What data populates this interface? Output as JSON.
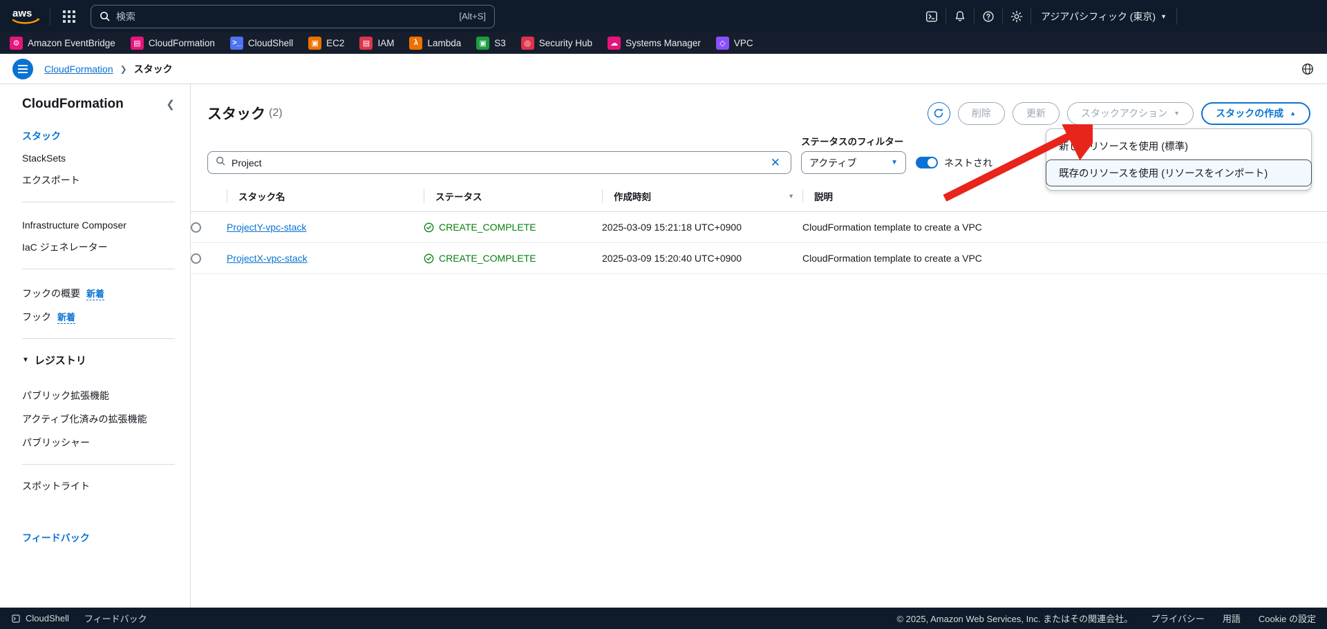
{
  "topnav": {
    "logo_alt": "aws",
    "search_placeholder": "検索",
    "search_shortcut": "[Alt+S]",
    "region_label": "アジアパシフィック (東京)",
    "caret": "▼",
    "icons": {
      "apps": "app-grid-icon",
      "search": "search-icon",
      "cloudshell": "cloudshell-icon",
      "notifications": "bell-icon",
      "help": "question-icon",
      "settings": "gear-icon"
    }
  },
  "favorites": [
    {
      "label": "Amazon EventBridge",
      "color": "#e7157b",
      "glyph": "⚙"
    },
    {
      "label": "CloudFormation",
      "color": "#e7157b",
      "glyph": "▤"
    },
    {
      "label": "CloudShell",
      "color": "#4d72f3",
      "glyph": ">_"
    },
    {
      "label": "EC2",
      "color": "#ed7100",
      "glyph": "▣"
    },
    {
      "label": "IAM",
      "color": "#dd344c",
      "glyph": "▤"
    },
    {
      "label": "Lambda",
      "color": "#ed7100",
      "glyph": "λ"
    },
    {
      "label": "S3",
      "color": "#1b9e3e",
      "glyph": "▣"
    },
    {
      "label": "Security Hub",
      "color": "#dd344c",
      "glyph": "◎"
    },
    {
      "label": "Systems Manager",
      "color": "#e7157b",
      "glyph": "☁"
    },
    {
      "label": "VPC",
      "color": "#8c4fff",
      "glyph": "◇"
    }
  ],
  "breadcrumb": {
    "root": "CloudFormation",
    "separator": "❯",
    "current": "スタック",
    "right_icon": "region-globe-icon"
  },
  "sidebar": {
    "title": "CloudFormation",
    "collapse_icon": "❮",
    "items": [
      {
        "label": "スタック",
        "active": true
      },
      {
        "label": "StackSets",
        "active": false
      },
      {
        "label": "エクスポート",
        "active": false
      }
    ],
    "items2": [
      {
        "label": "Infrastructure Composer"
      },
      {
        "label": "IaC ジェネレーター"
      }
    ],
    "items3": [
      {
        "label": "フックの概要",
        "badge": "新着"
      },
      {
        "label": "フック",
        "badge": "新着"
      }
    ],
    "registry_group": "レジストリ",
    "registry_caret": "▼",
    "registry_items": [
      {
        "label": "パブリック拡張機能"
      },
      {
        "label": "アクティブ化済みの拡張機能"
      },
      {
        "label": "パブリッシャー"
      }
    ],
    "spotlight": "スポットライト",
    "feedback": "フィードバック"
  },
  "panel": {
    "title": "スタック",
    "count": "(2)",
    "refresh_icon": "refresh-icon",
    "buttons": {
      "delete": "削除",
      "update": "更新",
      "stack_actions": "スタックアクション",
      "create_stack": "スタックの作成"
    },
    "caret_down": "▼",
    "caret_up": "▲",
    "dropdown": [
      {
        "label": "新しいリソースを使用 (標準)",
        "hover": false
      },
      {
        "label": "既存のリソースを使用 (リソースをインポート)",
        "hover": true
      }
    ]
  },
  "filters": {
    "search_value": "Project",
    "search_placeholder": "Project",
    "clear_icon": "✕",
    "status_label": "ステータスのフィルター",
    "status_value": "アクティブ",
    "status_caret": "▼",
    "nested_toggle_label": "ネストされ",
    "toggle_on": true
  },
  "table": {
    "columns": [
      "スタック名",
      "ステータス",
      "作成時刻",
      "説明"
    ],
    "sort_caret": "▼",
    "rows": [
      {
        "name": "ProjectY-vpc-stack",
        "status": "CREATE_COMPLETE",
        "created": "2025-03-09 15:21:18 UTC+0900",
        "description": "CloudFormation template to create a VPC"
      },
      {
        "name": "ProjectX-vpc-stack",
        "status": "CREATE_COMPLETE",
        "created": "2025-03-09 15:20:40 UTC+0900",
        "description": "CloudFormation template to create a VPC"
      }
    ],
    "status_color": "#037f0c"
  },
  "footer": {
    "cloudshell": "CloudShell",
    "feedback": "フィードバック",
    "copyright": "© 2025, Amazon Web Services, Inc. またはその関連会社。",
    "privacy": "プライバシー",
    "terms": "用語",
    "cookies": "Cookie の設定"
  },
  "annotation": {
    "arrow_color": "#e8251b",
    "arrow_name": "red-pointer-arrow"
  }
}
